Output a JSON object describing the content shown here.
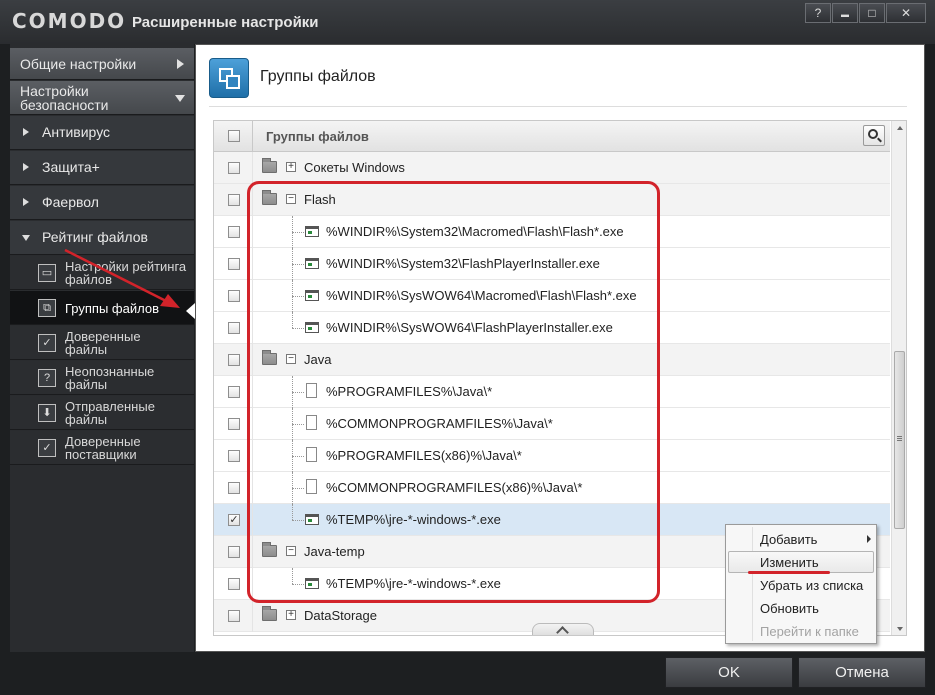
{
  "app": {
    "brand": "COMODO",
    "window_title": "Расширенные настройки",
    "buttons": {
      "help": "?",
      "minimize": "▬",
      "maximize": "□",
      "close": "✕"
    }
  },
  "sidebar": {
    "general": "Общие настройки",
    "security": "Настройки безопасности",
    "sections": [
      {
        "label": "Антивирус"
      },
      {
        "label": "Защита+"
      },
      {
        "label": "Фаервол"
      },
      {
        "label": "Рейтинг файлов"
      }
    ],
    "file_rating_items": [
      {
        "label": "Настройки рейтинга файлов",
        "icon": "settings-list-icon"
      },
      {
        "label": "Группы файлов",
        "icon": "file-groups-icon",
        "active": true
      },
      {
        "label": "Доверенные файлы",
        "icon": "checkmark-doc-icon"
      },
      {
        "label": "Неопознанные файлы",
        "icon": "question-doc-icon"
      },
      {
        "label": "Отправленные файлы",
        "icon": "upload-doc-icon"
      },
      {
        "label": "Доверенные поставщики",
        "icon": "trusted-vendor-icon"
      }
    ]
  },
  "main": {
    "title": "Группы файлов",
    "table": {
      "header": "Группы файлов",
      "rows": [
        {
          "type": "group",
          "expanded": false,
          "label": "Сокеты Windows"
        },
        {
          "type": "group",
          "expanded": true,
          "label": "Flash"
        },
        {
          "type": "exe",
          "label": "%WINDIR%\\System32\\Macromed\\Flash\\Flash*.exe"
        },
        {
          "type": "exe",
          "label": "%WINDIR%\\System32\\FlashPlayerInstaller.exe"
        },
        {
          "type": "exe",
          "label": "%WINDIR%\\SysWOW64\\Macromed\\Flash\\Flash*.exe"
        },
        {
          "type": "exe",
          "label": "%WINDIR%\\SysWOW64\\FlashPlayerInstaller.exe"
        },
        {
          "type": "group",
          "expanded": true,
          "label": "Java"
        },
        {
          "type": "doc",
          "label": "%PROGRAMFILES%\\Java\\*"
        },
        {
          "type": "doc",
          "label": "%COMMONPROGRAMFILES%\\Java\\*"
        },
        {
          "type": "doc",
          "label": "%PROGRAMFILES(x86)%\\Java\\*"
        },
        {
          "type": "doc",
          "label": "%COMMONPROGRAMFILES(x86)%\\Java\\*"
        },
        {
          "type": "exe",
          "label": "%TEMP%\\jre-*-windows-*.exe",
          "checked": true,
          "selected": true
        },
        {
          "type": "group",
          "expanded": true,
          "label": "Java-temp"
        },
        {
          "type": "exe",
          "label": "%TEMP%\\jre-*-windows-*.exe"
        },
        {
          "type": "group",
          "expanded": false,
          "label": "DataStorage"
        }
      ]
    }
  },
  "context_menu": {
    "items": [
      {
        "label": "Добавить",
        "submenu": true
      },
      {
        "label": "Изменить",
        "highlighted": true
      },
      {
        "label": "Убрать из списка"
      },
      {
        "label": "Обновить"
      },
      {
        "label": "Перейти к папке",
        "disabled": true
      }
    ]
  },
  "footer": {
    "ok": "OK",
    "cancel": "Отмена"
  },
  "colors": {
    "annotation": "#d2232a",
    "selection": "#d8e7f5",
    "accent": "#2a7dbf"
  }
}
